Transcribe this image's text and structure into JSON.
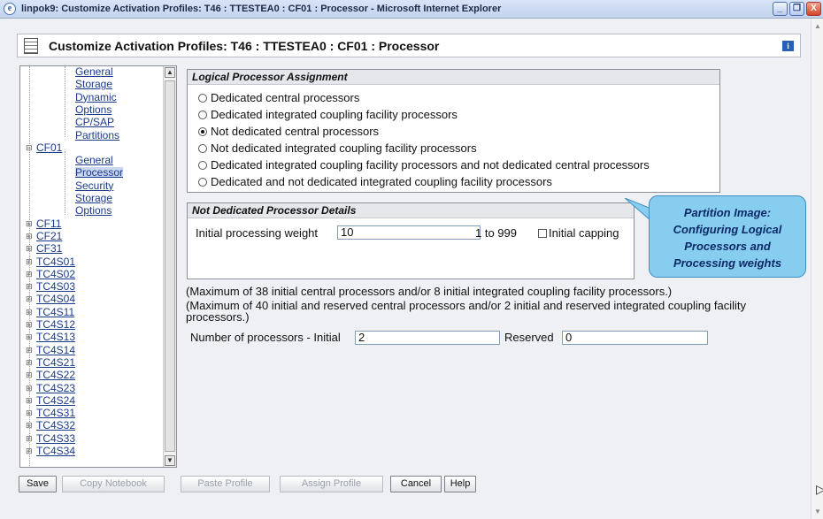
{
  "window": {
    "title": "linpok9: Customize Activation Profiles: T46 : TTESTEA0 : CF01 : Processor - Microsoft Internet Explorer",
    "ie_icon": "e",
    "minimize_glyph": "_",
    "restore_glyph": "❐",
    "close_glyph": "X"
  },
  "header": {
    "title": "Customize Activation Profiles: T46 : TTESTEA0 : CF01 : Processor",
    "info_glyph": "i"
  },
  "tree": {
    "items": [
      {
        "label": "General",
        "expander": "",
        "selected": false
      },
      {
        "label": "Storage",
        "expander": "",
        "selected": false
      },
      {
        "label": "Dynamic",
        "expander": "",
        "selected": false
      },
      {
        "label": "Options",
        "expander": "",
        "selected": false
      },
      {
        "label": "CP/SAP",
        "expander": "",
        "selected": false
      },
      {
        "label": "Partitions",
        "expander": "",
        "selected": false
      },
      {
        "label": "CF01",
        "expander": "⊟",
        "selected": false
      },
      {
        "label": "General",
        "expander": "",
        "selected": false
      },
      {
        "label": "Processor",
        "expander": "",
        "selected": true
      },
      {
        "label": "Security",
        "expander": "",
        "selected": false
      },
      {
        "label": "Storage",
        "expander": "",
        "selected": false
      },
      {
        "label": "Options",
        "expander": "",
        "selected": false
      },
      {
        "label": "CF11",
        "expander": "⊞",
        "selected": false
      },
      {
        "label": "CF21",
        "expander": "⊞",
        "selected": false
      },
      {
        "label": "CF31",
        "expander": "⊞",
        "selected": false
      },
      {
        "label": "TC4S01",
        "expander": "⊞",
        "selected": false
      },
      {
        "label": "TC4S02",
        "expander": "⊞",
        "selected": false
      },
      {
        "label": "TC4S03",
        "expander": "⊞",
        "selected": false
      },
      {
        "label": "TC4S04",
        "expander": "⊞",
        "selected": false
      },
      {
        "label": "TC4S11",
        "expander": "⊞",
        "selected": false
      },
      {
        "label": "TC4S12",
        "expander": "⊞",
        "selected": false
      },
      {
        "label": "TC4S13",
        "expander": "⊞",
        "selected": false
      },
      {
        "label": "TC4S14",
        "expander": "⊞",
        "selected": false
      },
      {
        "label": "TC4S21",
        "expander": "⊞",
        "selected": false
      },
      {
        "label": "TC4S22",
        "expander": "⊞",
        "selected": false
      },
      {
        "label": "TC4S23",
        "expander": "⊞",
        "selected": false
      },
      {
        "label": "TC4S24",
        "expander": "⊞",
        "selected": false
      },
      {
        "label": "TC4S31",
        "expander": "⊞",
        "selected": false
      },
      {
        "label": "TC4S32",
        "expander": "⊞",
        "selected": false
      },
      {
        "label": "TC4S33",
        "expander": "⊞",
        "selected": false
      },
      {
        "label": "TC4S34",
        "expander": "⊞",
        "selected": false
      }
    ],
    "scroll_up_glyph": "▲",
    "scroll_down_glyph": "▼"
  },
  "logical_assignment": {
    "heading": "Logical Processor Assignment",
    "options": [
      {
        "label": "Dedicated central processors",
        "checked": false
      },
      {
        "label": "Dedicated integrated coupling facility processors",
        "checked": false
      },
      {
        "label": "Not dedicated central processors",
        "checked": true
      },
      {
        "label": "Not dedicated integrated coupling facility processors",
        "checked": false
      },
      {
        "label": "Dedicated integrated coupling facility processors and not dedicated central processors",
        "checked": false
      },
      {
        "label": "Dedicated and not dedicated integrated coupling facility processors",
        "checked": false
      }
    ]
  },
  "not_dedicated_details": {
    "heading": "Not Dedicated Processor Details",
    "weight_label": "Initial processing weight",
    "weight_value": "10",
    "range_label": "1 to 999",
    "capping_label": "Initial capping",
    "capping_checked": false
  },
  "callout": {
    "lines": [
      "Partition Image:",
      "Configuring Logical",
      "Processors and",
      "Processing weights"
    ],
    "fill_color": "#86cdf0"
  },
  "notes": {
    "max_initial": "(Maximum of 38 initial central processors and/or 8 initial integrated coupling facility processors.)",
    "max_reserved": "(Maximum of 40 initial and reserved central processors and/or 2 initial and reserved integrated coupling facility processors.)"
  },
  "processors": {
    "initial_label": "Number of processors - Initial",
    "initial_value": "2",
    "reserved_label": "Reserved",
    "reserved_value": "0"
  },
  "buttons": {
    "save": "Save",
    "copy_notebook": "Copy Notebook",
    "paste_profile": "Paste Profile",
    "assign_profile": "Assign Profile",
    "cancel": "Cancel",
    "help": "Help"
  }
}
